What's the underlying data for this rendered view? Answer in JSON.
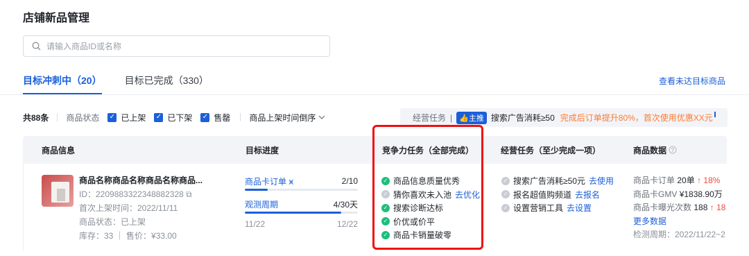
{
  "page": {
    "title": "店铺新品管理"
  },
  "search": {
    "placeholder": "请输入商品ID或名称"
  },
  "tabs": [
    {
      "label": "目标冲刺中（20）",
      "active": true
    },
    {
      "label": "目标已完成（330）",
      "active": false
    }
  ],
  "header_link": "查看未达目标商品",
  "filter": {
    "total": "共88条",
    "status_label": "商品状态",
    "options": [
      "已上架",
      "已下架",
      "售罄"
    ],
    "sort": "商品上架时间倒序"
  },
  "banner": {
    "task_label": "经营任务",
    "badge": "主推",
    "condition": "搜索广告消耗≥50",
    "promo": "完成后订单提升80%，首次使用优惠XX元"
  },
  "table": {
    "headers": [
      "商品信息",
      "目标进度",
      "竞争力任务（全部完成）",
      "经营任务（至少完成一项）",
      "商品数据"
    ],
    "row": {
      "name": "商品名称商品名称商品名称商品...",
      "id": "ID：2209883322348882328",
      "first_listed": "首次上架时间：2022/11/11",
      "status": "商品状态：已上架",
      "stock_price": "库存：33 ｜ 售价：¥33.00",
      "progress": [
        {
          "label": "商品卡订单",
          "value": "2/10",
          "fill": 0.2
        },
        {
          "label": "观测周期",
          "value": "4/30天",
          "fill": 0.85
        }
      ],
      "date_start": "11/22",
      "date_end": "12/22",
      "competitive_tasks": [
        {
          "label": "商品信息质量优秀",
          "done": true,
          "action": ""
        },
        {
          "label": "猜你喜欢未入池",
          "done": false,
          "action": "去优化"
        },
        {
          "label": "搜索诊断达标",
          "done": true,
          "action": ""
        },
        {
          "label": "价优或价平",
          "done": true,
          "action": ""
        },
        {
          "label": "商品卡销量破零",
          "done": true,
          "action": ""
        }
      ],
      "business_tasks": [
        {
          "label": "搜索广告消耗≥50元",
          "action": "去使用"
        },
        {
          "label": "报名超值购频道",
          "action": "去报名"
        },
        {
          "label": "设置营销工具",
          "action": "去设置"
        }
      ],
      "metrics": [
        {
          "label": "商品卡订单",
          "value": "20单",
          "delta": "↑ 18%"
        },
        {
          "label": "商品卡GMV",
          "value": "¥1838.90万",
          "delta": ""
        },
        {
          "label": "商品卡曝光次数",
          "value": "188",
          "delta": "↑ 18"
        }
      ],
      "more": "更多数据",
      "period": "检测周期：2022/11/22~2"
    }
  },
  "colors": {
    "accent": "#1b5fd9",
    "success": "#1ebf7a",
    "warn": "#ff7a2f",
    "highlight": "#f00f0f"
  }
}
